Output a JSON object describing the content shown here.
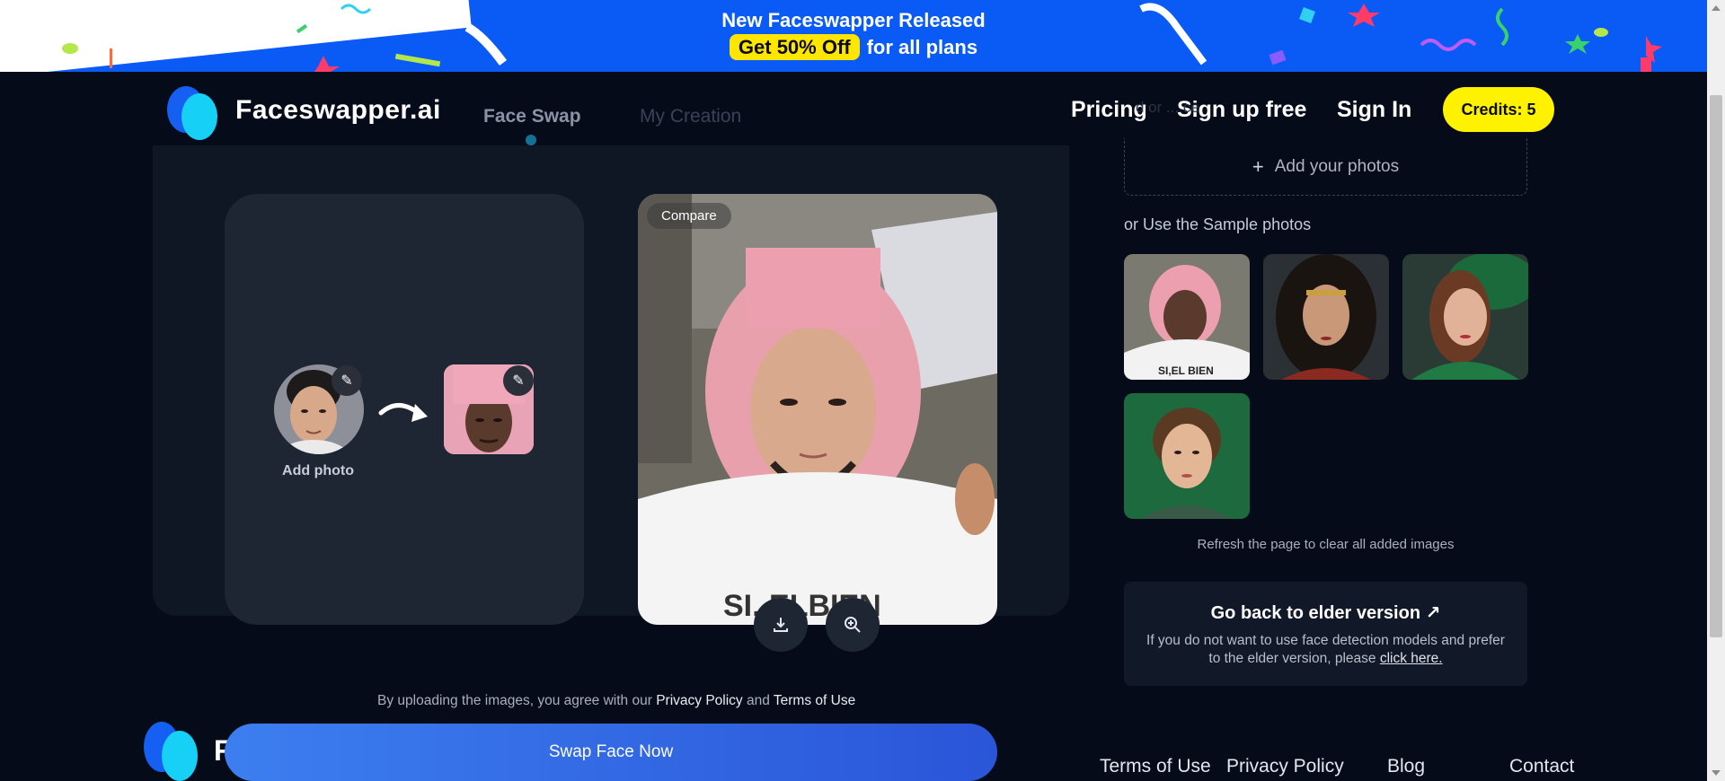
{
  "banner": {
    "line1": "New Faceswapper Released",
    "highlight": "Get 50% Off",
    "line2_rest": "for all plans",
    "background": "#0a5bf5",
    "highlight_color": "#ffe600"
  },
  "header": {
    "brand": "Faceswapper.ai",
    "tabs": [
      {
        "label": "Face Swap",
        "active": true
      },
      {
        "label": "My Creation",
        "active": false
      }
    ],
    "nav": {
      "pricing": "Pricing",
      "signup": "Sign up free",
      "signin": "Sign In"
    },
    "credits": "Credits: 5",
    "credits_color": "#fff200"
  },
  "swap": {
    "add_photo_label": "Add photo",
    "compare_label": "Compare",
    "download_icon": "download-icon",
    "zoom_icon": "zoom-in-icon",
    "agree_prefix": "By uploading the images, you agree with our",
    "privacy_link": "Privacy Policy",
    "and_word": "and",
    "terms_link": "Terms of Use",
    "swap_button": "Swap Face Now"
  },
  "sidebar": {
    "faded_label": "d or ... ce",
    "add_photos": "Add your photos",
    "sample_label": "or Use the Sample photos",
    "samples": [
      "sample-photo-pink-wig",
      "sample-photo-warrior-woman",
      "sample-photo-green-hat-woman",
      "sample-photo-green-background-woman"
    ],
    "refresh_note": "Refresh the page to clear all added images",
    "elder": {
      "title": "Go back to elder version ↗",
      "desc_prefix": "If you do not want to use face detection models and prefer to the elder version, please",
      "link": "click here."
    }
  },
  "footer": {
    "links": [
      "Terms of Use",
      "Privacy Policy",
      "Blog",
      "Contact"
    ],
    "logo_letter": "F"
  },
  "colors": {
    "page_bg": "#050b18",
    "panel_bg": "#0f1624",
    "card_bg": "#1e2533",
    "button_gradient_start": "#3c7ef0",
    "button_gradient_end": "#2a55d8"
  }
}
